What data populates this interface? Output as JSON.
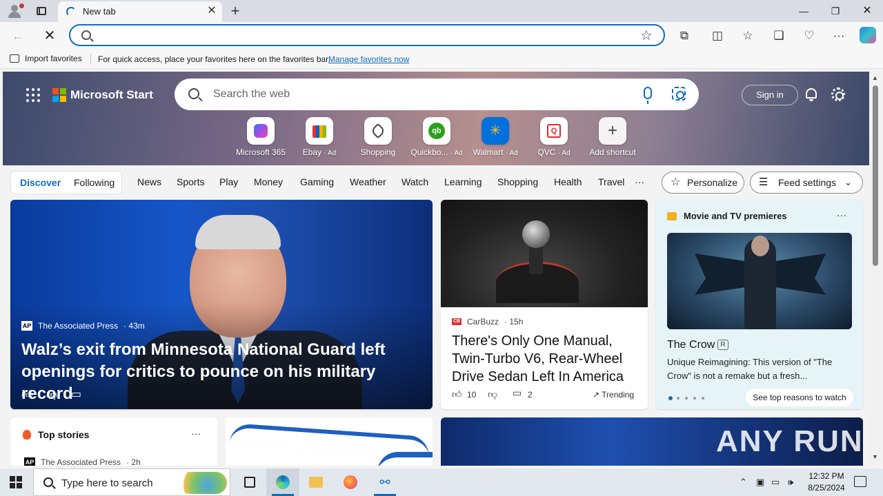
{
  "browser": {
    "tab_title": "New tab",
    "address_placeholder": "",
    "favorites_bar": {
      "import_label": "Import favorites",
      "message": "For quick access, place your favorites here on the favorites bar.",
      "manage_link": "Manage favorites now"
    }
  },
  "start_page": {
    "brand": "Microsoft Start",
    "search_placeholder": "Search the web",
    "sign_in": "Sign in",
    "shortcuts": [
      {
        "label": "Microsoft 365",
        "ad": "",
        "icon": "microsoft-365-icon",
        "color": "#7b5cf0"
      },
      {
        "label": "Ebay",
        "ad": "· Ad",
        "icon": "ebay-bag-icon",
        "color": "#e53238"
      },
      {
        "label": "Shopping",
        "ad": "",
        "icon": "tag-icon",
        "color": "#444444"
      },
      {
        "label": "Quickbo...",
        "ad": "· Ad",
        "icon": "quickbooks-icon",
        "color": "#2ca01c"
      },
      {
        "label": "Walmart",
        "ad": "· Ad",
        "icon": "walmart-spark-icon",
        "color": "#0071dc"
      },
      {
        "label": "QVC",
        "ad": "· Ad",
        "icon": "qvc-icon",
        "color": "#e3262f"
      },
      {
        "label": "Add shortcut",
        "ad": "",
        "icon": "plus-icon",
        "color": "#444444"
      }
    ],
    "feed_tabs": [
      "Discover",
      "Following"
    ],
    "categories": [
      "News",
      "Sports",
      "Play",
      "Money",
      "Gaming",
      "Weather",
      "Watch",
      "Learning",
      "Shopping",
      "Health",
      "Travel"
    ],
    "more_label": "···",
    "personalize": "Personalize",
    "feed_settings": "Feed settings"
  },
  "cards": {
    "main": {
      "source": "The Associated Press",
      "time": "· 43m",
      "title": "Walz’s exit from Minnesota National Guard left openings for critics to pounce on his military record"
    },
    "car": {
      "source": "CarBuzz",
      "time": "· 15h",
      "title": "There's Only One Manual, Twin-Turbo V6, Rear-Wheel Drive Sedan Left In America",
      "likes": "10",
      "comments": "2",
      "trending": "Trending"
    },
    "movie": {
      "header": "Movie and TV premieres",
      "title": "The Crow",
      "rating": "R",
      "description": "Unique Reimagining: This version of \"The Crow\" is not a remake but a fresh...",
      "cta": "See top reasons to watch"
    },
    "top_stories": {
      "header": "Top stories",
      "source": "The Associated Press",
      "time": "· 2h"
    }
  },
  "watermark": "ANY RUN",
  "taskbar": {
    "search_placeholder": "Type here to search",
    "time": "12:32 PM",
    "date": "8/25/2024"
  },
  "colors": {
    "accent": "#0f6cbd",
    "main_card": "#1656c8",
    "movie_card": "#e6f4f7"
  }
}
